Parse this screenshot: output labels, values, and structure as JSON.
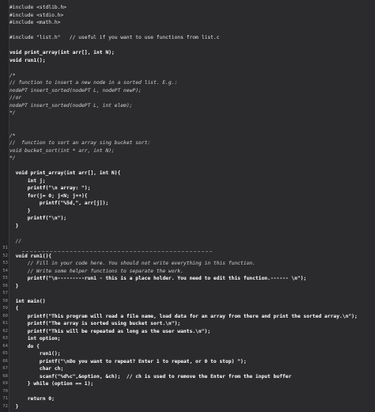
{
  "editor": {
    "lines": [
      {
        "num": "",
        "text": "#include <stdlib.h>",
        "kind": "pre"
      },
      {
        "num": "",
        "text": "#include <stdio.h>",
        "kind": "pre"
      },
      {
        "num": "",
        "text": "#include <math.h>",
        "kind": "pre"
      },
      {
        "num": "",
        "text": "",
        "kind": "code"
      },
      {
        "num": "",
        "text": "#include \"list.h\"   // useful if you want to use functions from list.c",
        "kind": "pre"
      },
      {
        "num": "",
        "text": "",
        "kind": "code"
      },
      {
        "num": "",
        "text": "void print_array(int arr[], int N);",
        "kind": "code"
      },
      {
        "num": "",
        "text": "void run1();",
        "kind": "code"
      },
      {
        "num": "",
        "text": "",
        "kind": "code"
      },
      {
        "num": "",
        "text": "/*",
        "kind": "cmt"
      },
      {
        "num": "",
        "text": "// function to insert a new node in a sorted list. E.g.:",
        "kind": "cmt"
      },
      {
        "num": "",
        "text": "nodePT insert_sorted(nodePT L, nodePT newP);",
        "kind": "cmt"
      },
      {
        "num": "",
        "text": "//or",
        "kind": "cmt"
      },
      {
        "num": "",
        "text": "nodePT insert_sorted(nodePT L, int elem);",
        "kind": "cmt"
      },
      {
        "num": "",
        "text": "*/",
        "kind": "cmt"
      },
      {
        "num": "",
        "text": "",
        "kind": "code"
      },
      {
        "num": "",
        "text": "",
        "kind": "code"
      },
      {
        "num": "",
        "text": "/*",
        "kind": "cmt"
      },
      {
        "num": "",
        "text": "//  function to sort an array sing bucket sort:",
        "kind": "cmt"
      },
      {
        "num": "",
        "text": "void bucket_sort(int * arr, int N);",
        "kind": "cmt"
      },
      {
        "num": "",
        "text": "*/",
        "kind": "cmt"
      },
      {
        "num": "",
        "text": "",
        "kind": "code"
      },
      {
        "num": "",
        "text": "  void print_array(int arr[], int N){",
        "kind": "code"
      },
      {
        "num": "",
        "text": "      int j;",
        "kind": "code"
      },
      {
        "num": "",
        "text": "      printf(\"\\n array: \");",
        "kind": "code"
      },
      {
        "num": "",
        "text": "      for(j= 0; j<N; j++){",
        "kind": "code"
      },
      {
        "num": "",
        "text": "          printf(\"%5d,\", arr[j]);",
        "kind": "code"
      },
      {
        "num": "",
        "text": "      }",
        "kind": "code"
      },
      {
        "num": "",
        "text": "      printf(\"\\n\");",
        "kind": "code"
      },
      {
        "num": "",
        "text": "  }",
        "kind": "code"
      },
      {
        "num": "",
        "text": "",
        "kind": "code"
      },
      {
        "num": "",
        "text": "  //",
        "kind": "cmt"
      },
      {
        "num": "",
        "text": "",
        "kind": "code"
      },
      {
        "num": "",
        "text": "  void run1(){",
        "kind": "code"
      },
      {
        "num": "",
        "text": "      // Fill in your code here. You should not write everything in this function.",
        "kind": "cmt"
      },
      {
        "num": "",
        "text": "      // Write some helper functions to separate the work.",
        "kind": "cmt"
      },
      {
        "num": "",
        "text": "      printf(\"\\n---------run1 - this is a place holder. You need to edit this function.------ \\n\");",
        "kind": "code"
      },
      {
        "num": "",
        "text": "  }",
        "kind": "code"
      },
      {
        "num": "",
        "text": "",
        "kind": "code"
      },
      {
        "num": "",
        "text": "  int main()",
        "kind": "code"
      },
      {
        "num": "",
        "text": "  {",
        "kind": "code"
      },
      {
        "num": "",
        "text": "      printf(\"This program will read a file name, load data for an array from there and print the sorted array.\\n\");",
        "kind": "code"
      },
      {
        "num": "",
        "text": "      printf(\"The array is sorted using bucket sort.\\n\");",
        "kind": "code"
      },
      {
        "num": "",
        "text": "      printf(\"This will be repeated as long as the user wants.\\n\");",
        "kind": "code"
      },
      {
        "num": "",
        "text": "      int option;",
        "kind": "code"
      },
      {
        "num": "",
        "text": "      do {",
        "kind": "code"
      },
      {
        "num": "",
        "text": "          run1();",
        "kind": "code"
      },
      {
        "num": "",
        "text": "          printf(\"\\nDo you want to repeat? Enter 1 to repeat, or 0 to stop) \");",
        "kind": "code"
      },
      {
        "num": "",
        "text": "          char ch;",
        "kind": "code"
      },
      {
        "num": "",
        "text": "          scanf(\"%d%c\",&option, &ch);  // ch is used to remove the Enter from the input buffer",
        "kind": "code"
      },
      {
        "num": "",
        "text": "      } while (option == 1);",
        "kind": "code"
      },
      {
        "num": "",
        "text": "",
        "kind": "code"
      },
      {
        "num": "",
        "text": "      return 0;",
        "kind": "code"
      },
      {
        "num": "",
        "text": "  }",
        "kind": "code"
      }
    ],
    "visible_line_numbers": [
      "51",
      "52",
      "53",
      "54",
      "55",
      "56",
      "57",
      "58",
      "59",
      "60",
      "61",
      "62",
      "63",
      "64",
      "65",
      "66",
      "67",
      "68",
      "69",
      "70",
      "71",
      "72"
    ]
  }
}
